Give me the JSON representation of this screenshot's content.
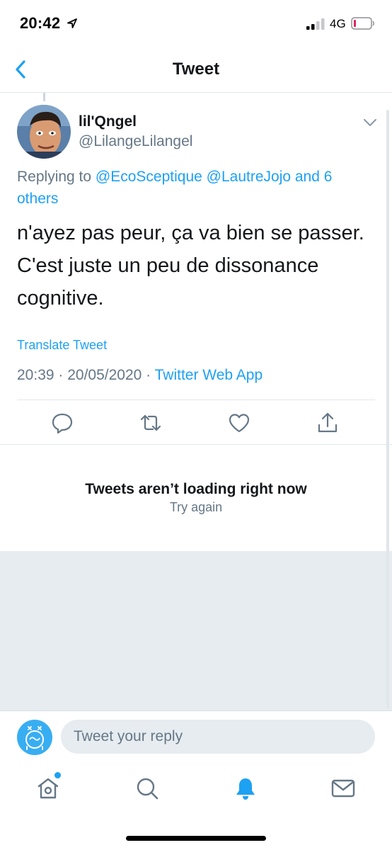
{
  "status_bar": {
    "time": "20:42",
    "network": "4G",
    "location_icon": "location-arrow-icon",
    "signal_icon": "cellular-signal-icon",
    "battery_icon": "battery-low-icon"
  },
  "nav": {
    "title": "Tweet",
    "back_icon": "chevron-left-icon"
  },
  "tweet": {
    "display_name": "lil'Qngel",
    "handle": "@LilangeLilangel",
    "replying_prefix": "Replying to",
    "replying_mentions": "@EcoSceptique @LautreJojo and 6 others",
    "text": "n'ayez pas peur, ça va bien se passer. C'est juste un peu de dissonance cognitive.",
    "translate_label": "Translate Tweet",
    "timestamp": "20:39 · 20/05/2020 · ",
    "source": "Twitter Web App",
    "actions": [
      "reply-icon",
      "retweet-icon",
      "like-icon",
      "share-icon"
    ]
  },
  "error": {
    "title": "Tweets aren’t loading right now",
    "retry_label": "Try again"
  },
  "compose": {
    "placeholder": "Tweet your reply"
  },
  "tab_bar": {
    "items": [
      "home-icon",
      "search-icon",
      "notifications-bell-icon",
      "messages-mail-icon"
    ],
    "active": "notifications-bell-icon"
  },
  "colors": {
    "accent": "#1da1f2",
    "secondary_text": "#657786",
    "primary_text": "#14171a",
    "battery_low": "#e0245e"
  }
}
